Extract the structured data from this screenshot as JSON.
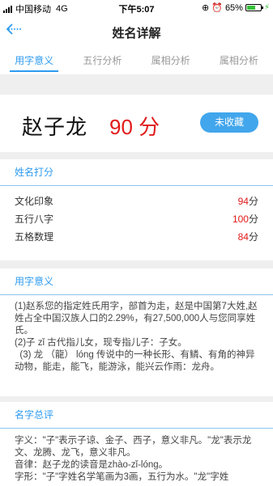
{
  "status": {
    "carrier": "中国移动",
    "network": "4G",
    "time": "下午5:07",
    "battery": "65%",
    "battery_level": 0.65
  },
  "header": {
    "back_icon": "back-arrow-icon",
    "title": "姓名详解"
  },
  "tabs": [
    {
      "label": "用字意义",
      "active": true
    },
    {
      "label": "五行分析",
      "active": false
    },
    {
      "label": "属相分析",
      "active": false
    },
    {
      "label": "属相分析",
      "active": false
    }
  ],
  "name_card": {
    "name": "赵子龙",
    "score": "90 分",
    "collect_label": "未收藏"
  },
  "scoring": {
    "title": "姓名打分",
    "rows": [
      {
        "label": "文化印象",
        "value": "94",
        "unit": "分"
      },
      {
        "label": "五行八字",
        "value": "100",
        "unit": "分"
      },
      {
        "label": "五格数理",
        "value": "84",
        "unit": "分"
      }
    ]
  },
  "meaning": {
    "title": "用字意义",
    "paragraphs": [
      "(1)赵系您的指定姓氏用字，部首为走，赵是中国第7大姓,赵姓占全中国汉族人口的2.29%，有27,500,000人与您同享姓氏。",
      "(2)子 zǐ 古代指儿女，现专指儿子：子女。",
      "  (3) 龙 （龍） lóng 传说中的一种长形、有鳞、有角的神异动物，能走，能飞，能游泳，能兴云作雨：龙舟。"
    ]
  },
  "summary": {
    "title": "名字总评",
    "paragraphs": [
      "字义：\"子\"表示子谅、金子、西子，意义非凡。\"龙\"表示龙文、龙腾、龙飞，意义非凡。",
      "音律：赵子龙的读音是zhào-zǐ-lóng。",
      "字形：\"子\"字姓名学笔画为3画，五行为水。\"龙\"字姓"
    ]
  }
}
